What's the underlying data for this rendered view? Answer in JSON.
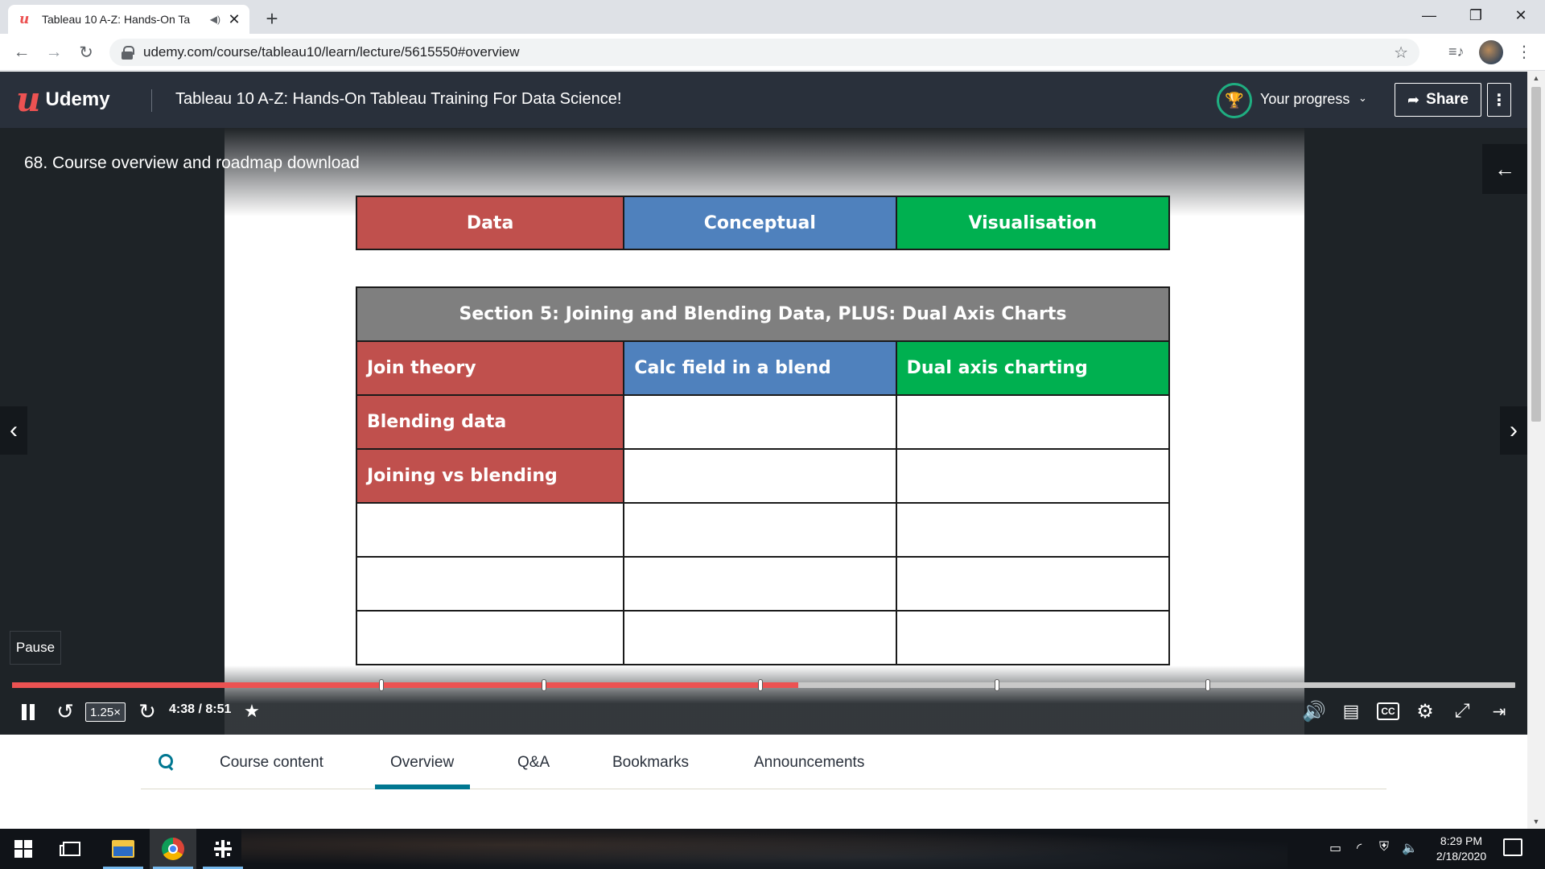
{
  "browser": {
    "tab_title": "Tableau 10 A-Z: Hands-On Ta",
    "url": "udemy.com/course/tableau10/learn/lecture/5615550#overview"
  },
  "header": {
    "logo_text": "Udemy",
    "course_title": "Tableau 10 A-Z: Hands-On Tableau Training For Data Science!",
    "progress_label": "Your progress",
    "share_label": "Share"
  },
  "video": {
    "lecture_title": "68. Course overview and roadmap download",
    "pause_tooltip": "Pause",
    "speed": "1.25×",
    "time": "4:38 / 8:51",
    "progress_fraction": 0.523
  },
  "slide": {
    "legend": [
      "Data",
      "Conceptual",
      "Visualisation"
    ],
    "section_title": "Section 5: Joining and Blending Data, PLUS: Dual Axis Charts",
    "rows": [
      [
        "Join theory",
        "Calc field in a blend",
        "Dual axis charting"
      ],
      [
        "Blending data",
        "",
        ""
      ],
      [
        "Joining vs blending",
        "",
        ""
      ],
      [
        "",
        "",
        ""
      ],
      [
        "",
        "",
        ""
      ],
      [
        "",
        "",
        ""
      ]
    ]
  },
  "subnav": {
    "tabs": [
      "Course content",
      "Overview",
      "Q&A",
      "Bookmarks",
      "Announcements"
    ],
    "active": "Overview"
  },
  "taskbar": {
    "time": "8:29 PM",
    "date": "2/18/2020"
  },
  "colors": {
    "udemy_red": "#ec5252",
    "data_red": "#c0504d",
    "conceptual_blue": "#4f81bd",
    "visualisation_green": "#00b050",
    "section_grey": "#7f7f7f",
    "header_bg": "#29303b",
    "teal_accent": "#007791"
  }
}
